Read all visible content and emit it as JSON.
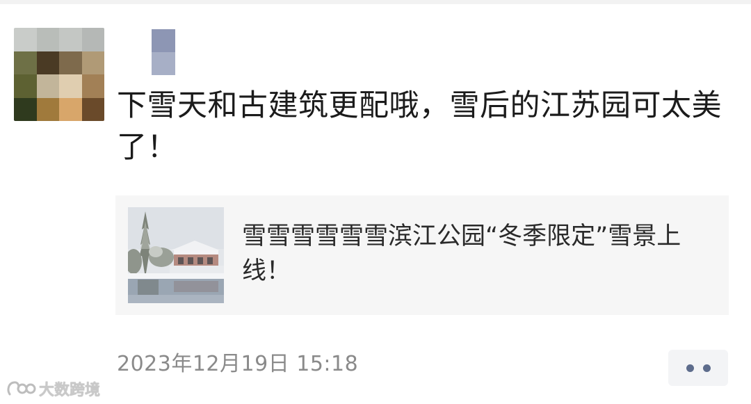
{
  "post": {
    "text": "下雪天和古建筑更配哦，雪后的江苏园可太美了！",
    "timestamp": "2023年12月19日  15:18"
  },
  "shared_article": {
    "title": "雪雪雪雪雪雪滨江公园“冬季限定”雪景上线！"
  },
  "more_button": {
    "icon": "more-dots-icon",
    "color": "#5d6c8c"
  },
  "watermark": {
    "text": "大数跨境",
    "logo": "dashujiajing-logo"
  },
  "colors": {
    "text_primary": "#1b1b1b",
    "text_secondary": "#8a8a8a",
    "card_background": "#f6f6f6",
    "link_blue": "#5d6c8c"
  }
}
